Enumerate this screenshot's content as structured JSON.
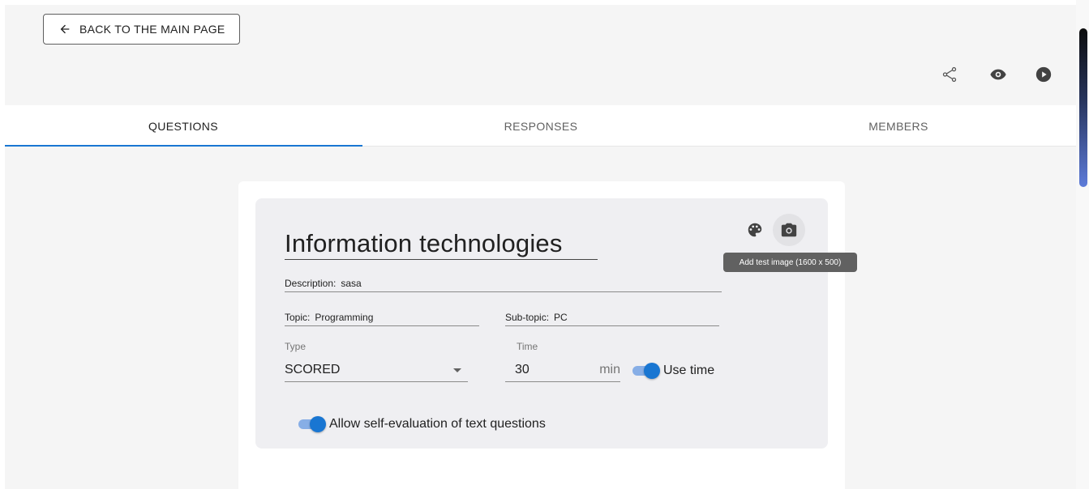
{
  "header": {
    "back_label": "BACK TO THE MAIN PAGE",
    "icons": [
      "share-icon",
      "eye-icon",
      "play-icon"
    ]
  },
  "tabs": [
    {
      "label": "QUESTIONS",
      "active": true
    },
    {
      "label": "RESPONSES",
      "active": false
    },
    {
      "label": "MEMBERS",
      "active": false
    }
  ],
  "form": {
    "title": "Information technologies",
    "description_label": "Description:",
    "description_value": "sasa",
    "topic_label": "Topic:",
    "topic_value": "Programming",
    "subtopic_label": "Sub-topic:",
    "subtopic_value": "PC",
    "type_label": "Type",
    "type_value": "SCORED",
    "time_label": "Time",
    "time_value": "30",
    "time_unit": "min",
    "use_time_label": "Use time",
    "use_time_on": true,
    "self_eval_label": "Allow self-evaluation of text questions",
    "self_eval_on": true
  },
  "tooltip": "Add test image (1600 x 500)",
  "colors": {
    "accent": "#1976d2",
    "toggle_track": "#87aee6",
    "tooltip_bg": "#616161",
    "page_bg": "#f5f5f5",
    "form_bg": "#efeff2"
  }
}
